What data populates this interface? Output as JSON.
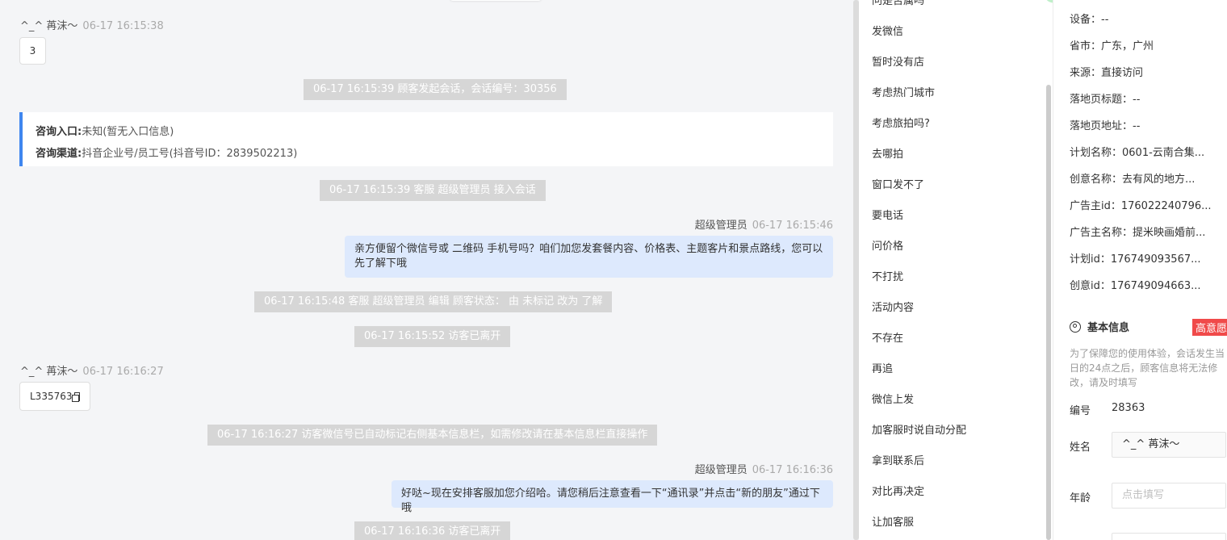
{
  "chat": {
    "messages": {
      "m1_sender": "^_^ 苒沫～",
      "m1_time": "06-17 16:15:38",
      "m1_text": "3",
      "sys1": "06-17 16:15:39 顾客发起会话，会话编号：30356",
      "card_entry_label": "咨询入口:",
      "card_entry_value": "未知(暂无入口信息)",
      "card_channel_label": "咨询渠道:",
      "card_channel_value": "抖音企业号/员工号(抖音号ID：2839502213)",
      "sys2": "06-17 16:15:39 客服 超级管理员 接入会话",
      "m2_sender": "超级管理员",
      "m2_time": "06-17 16:15:46",
      "m2_text": "亲方便留个微信号或 二维码 手机号吗？咱们加您发套餐内容、价格表、主题客片和景点路线，您可以先了解下哦",
      "sys3": "06-17 16:15:48 客服 超级管理员 编辑 顾客状态： 由 未标记 改为 了解",
      "sys4": "06-17 16:15:52 访客已离开",
      "m3_sender": "^_^ 苒沫～",
      "m3_time": "06-17 16:16:27",
      "m3_text": "L335763",
      "sys5": "06-17 16:16:27 访客微信号已自动标记右侧基本信息栏，如需修改请在基本信息栏直接操作",
      "m4_sender": "超级管理员",
      "m4_time": "06-17 16:16:36",
      "m4_text": "好哒~现在安排客服加您介绍哈。请您稍后注意查看一下“通讯录”并点击“新的朋友”通过下哦",
      "sys6": "06-17 16:16:36 访客已离开"
    }
  },
  "quick_replies": {
    "items": [
      "问是否属吗",
      "发微信",
      "暂时没有店",
      "考虑热门城市",
      "考虑旅拍吗?",
      "去哪拍",
      "窗口发不了",
      "要电话",
      "问价格",
      "不打扰",
      "活动内容",
      "不存在",
      "再追",
      "微信上发",
      "加客服时说自动分配",
      "拿到联系后",
      "对比再决定",
      "让加客服"
    ]
  },
  "customer": {
    "device": "设备：--",
    "province": "省市：广东，广州",
    "source": "来源：直接访问",
    "landing_title": "落地页标题：--",
    "landing_url": "落地页地址：--",
    "plan_name": "计划名称：0601-云南合集...",
    "creative_name": "创意名称：去有风的地方...",
    "advertiser_id": "广告主id：176022240796...",
    "advertiser_name": "广告主名称：提米映画婚前...",
    "plan_id": "计划id：176749093567...",
    "creative_id": "创意id：176749094663...",
    "basic_info_title": "基本信息",
    "intent_badge": "高意愿",
    "note": "为了保障您的使用体验，会话发生当日的24点之后，顾客信息将无法修改，请及时填写",
    "id_label": "编号",
    "id_value": "28363",
    "name_label": "姓名",
    "name_value": "^_^ 苒沫～",
    "age_label": "年龄",
    "age_placeholder": "点击填写"
  },
  "colors": {
    "accent_blue": "#3f86ef",
    "bubble_blue": "#dde9fd",
    "badge_red": "#f04a4a"
  }
}
